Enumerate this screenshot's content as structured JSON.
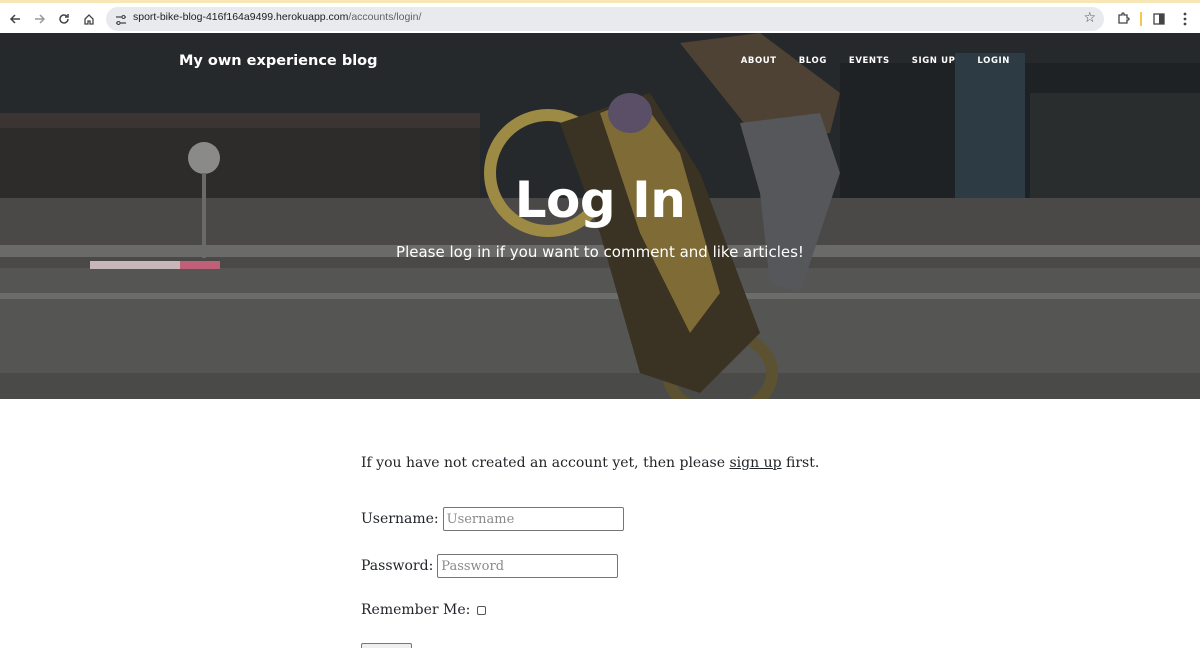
{
  "browser": {
    "url_domain": "sport-bike-blog-416f164a9499.herokuapp.com",
    "url_path": "/accounts/login/"
  },
  "site": {
    "brand": "My own experience blog",
    "nav": [
      "ABOUT",
      "BLOG",
      "EVENTS",
      "SIGN UP",
      "LOGIN"
    ]
  },
  "hero": {
    "title": "Log In",
    "subtitle": "Please log in if you want to comment and like articles!"
  },
  "form": {
    "intro_before": "If you have not created an account yet, then please ",
    "intro_link": "sign up",
    "intro_after": " first.",
    "username_label": "Username:",
    "username_placeholder": "Username",
    "password_label": "Password:",
    "password_placeholder": "Password",
    "remember_label": "Remember Me:"
  }
}
